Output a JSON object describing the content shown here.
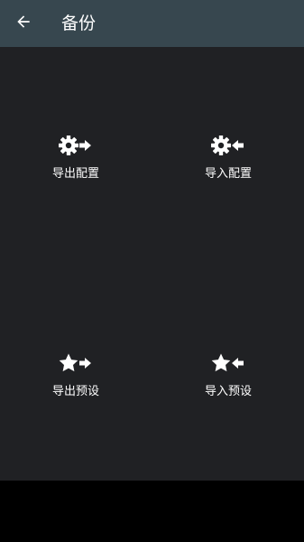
{
  "header": {
    "title": "备份",
    "back_icon": "arrow-left-icon"
  },
  "actions": [
    {
      "label": "导出配置",
      "icon": "gear-arrow-right-icon"
    },
    {
      "label": "导入配置",
      "icon": "gear-arrow-left-icon"
    },
    {
      "label": "导出预设",
      "icon": "star-arrow-right-icon"
    },
    {
      "label": "导入预设",
      "icon": "star-arrow-left-icon"
    }
  ],
  "colors": {
    "toolbar": "#37474f",
    "background": "#202124",
    "text": "#ffffff"
  }
}
